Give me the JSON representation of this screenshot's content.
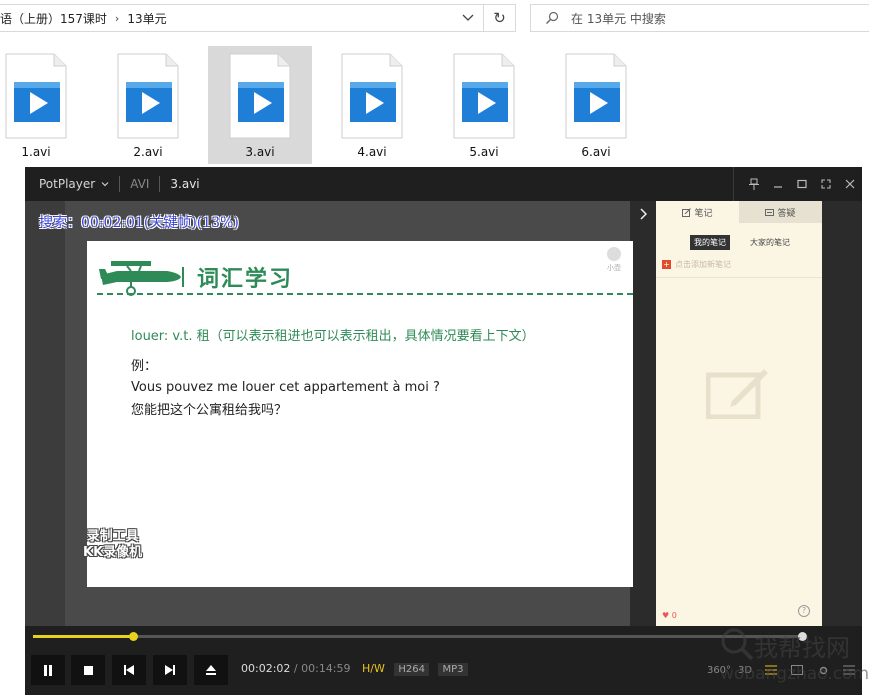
{
  "explorer": {
    "breadcrumb": [
      "语（上册）157课时",
      "13单元"
    ],
    "search_placeholder": "在 13单元 中搜索"
  },
  "files": [
    {
      "name": "1.avi",
      "selected": false
    },
    {
      "name": "2.avi",
      "selected": false
    },
    {
      "name": "3.avi",
      "selected": true
    },
    {
      "name": "4.avi",
      "selected": false
    },
    {
      "name": "5.avi",
      "selected": false
    },
    {
      "name": "6.avi",
      "selected": false
    }
  ],
  "player": {
    "app_name": "PotPlayer",
    "format": "AVI",
    "file": "3.avi",
    "osd": "搜索：00:02:01(关键帧)(13%)",
    "slide": {
      "heading": "词汇学习",
      "definition": "louer: v.t. 租（可以表示租进也可以表示租出，具体情况要看上下文）",
      "example_label": "例：",
      "example_fr": "Vous pouvez me louer cet appartement à moi ?",
      "example_zh": "您能把这个公寓租给我吗？",
      "badge": "小壶",
      "watermark_line1": "录制工具",
      "watermark_line2": "KK录像机"
    },
    "notes": {
      "tab_notes": "笔记",
      "tab_qa": "答疑",
      "my_notes": "我的笔记",
      "all_notes": "大家的笔记",
      "add_note": "点击添加新笔记",
      "likes": "0",
      "help": "?"
    },
    "time_current": "00:02:02",
    "time_total": "00:14:59",
    "hw": "H/W",
    "codec_video": "H264",
    "codec_audio": "MP3",
    "progress_fraction": 0.13,
    "icons_right": [
      "360°",
      "3D"
    ]
  },
  "site_watermark": {
    "cn": "我帮找网",
    "en": "wobangzhao.com"
  },
  "colors": {
    "accent_yellow": "#e8d21f",
    "slide_green": "#2e8b57",
    "osd_blue": "#3b46d6",
    "file_icon_blue": "#1f7fd6"
  }
}
